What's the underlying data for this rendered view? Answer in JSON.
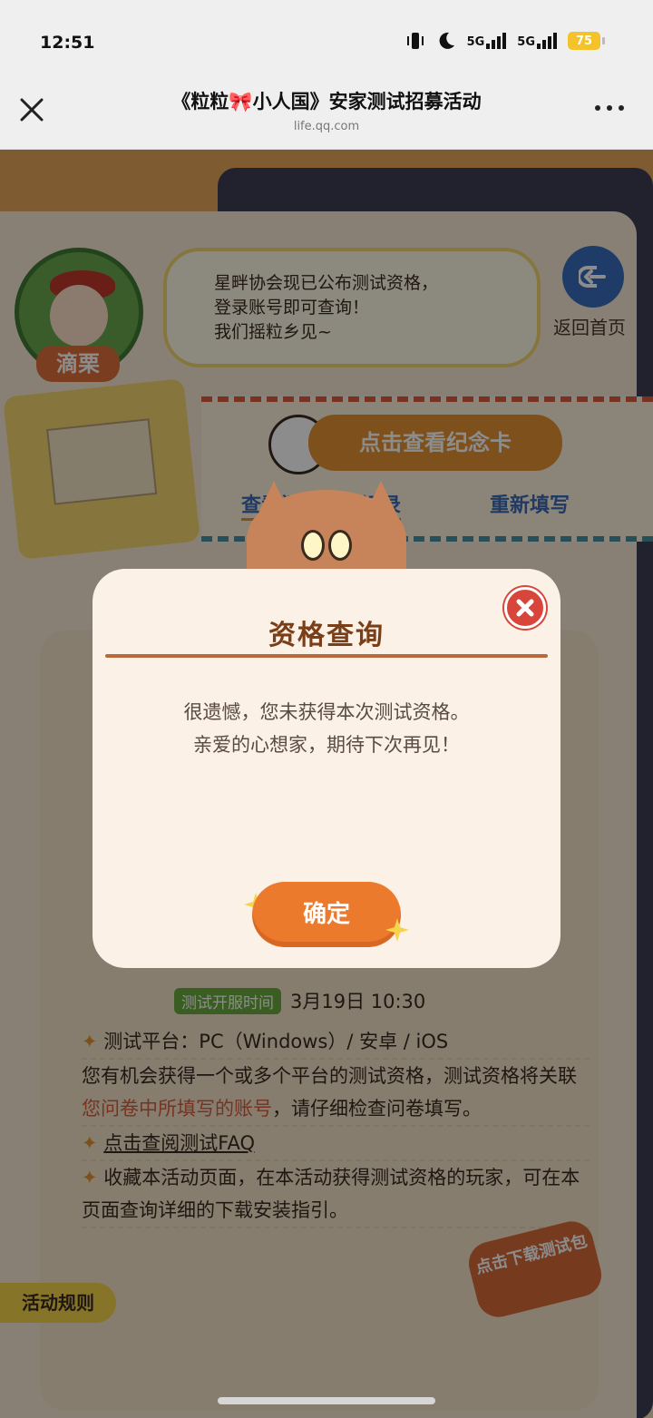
{
  "status_bar": {
    "time": "12:51",
    "signal1": "5G",
    "signal2": "5G",
    "battery": "75"
  },
  "nav": {
    "title": "《粒粒🎀小人国》安家测试招募活动",
    "subtitle": "life.qq.com"
  },
  "page": {
    "avatar_name": "滴栗",
    "speech": [
      "星畔协会现已公布测试资格，",
      "登录账号即可查询！",
      "我们摇粒乡见~"
    ],
    "home_label": "返回首页",
    "memo_button": "点击查看纪念卡",
    "record_link": "查看问卷填写记录",
    "refill_link": "重新填写",
    "test_time_tag": "测试开服时间",
    "test_time": "3月19日  10:30",
    "info_items": [
      "测试平台：PC（Windows）/ 安卓 / iOS",
      "您有机会获得一个或多个平台的测试资格，测试资格将关联",
      "您问卷中所填写的账号",
      "，请仔细检查问卷填写。",
      "点击查阅测试FAQ",
      "收藏本活动页面，在本活动获得测试资格的玩家，可在本页面查询详细的下载安装指引。"
    ],
    "download_tag": "点击下载测试包",
    "rules_tab": "活动规则"
  },
  "modal": {
    "title": "资格查询",
    "message_line1": "很遗憾，您未获得本次测试资格。",
    "message_line2": "亲爱的心想家，期待下次再见！",
    "confirm": "确定"
  },
  "colors": {
    "accent": "#ec7a2c",
    "close": "#d8463b",
    "title": "#7a3e18"
  }
}
